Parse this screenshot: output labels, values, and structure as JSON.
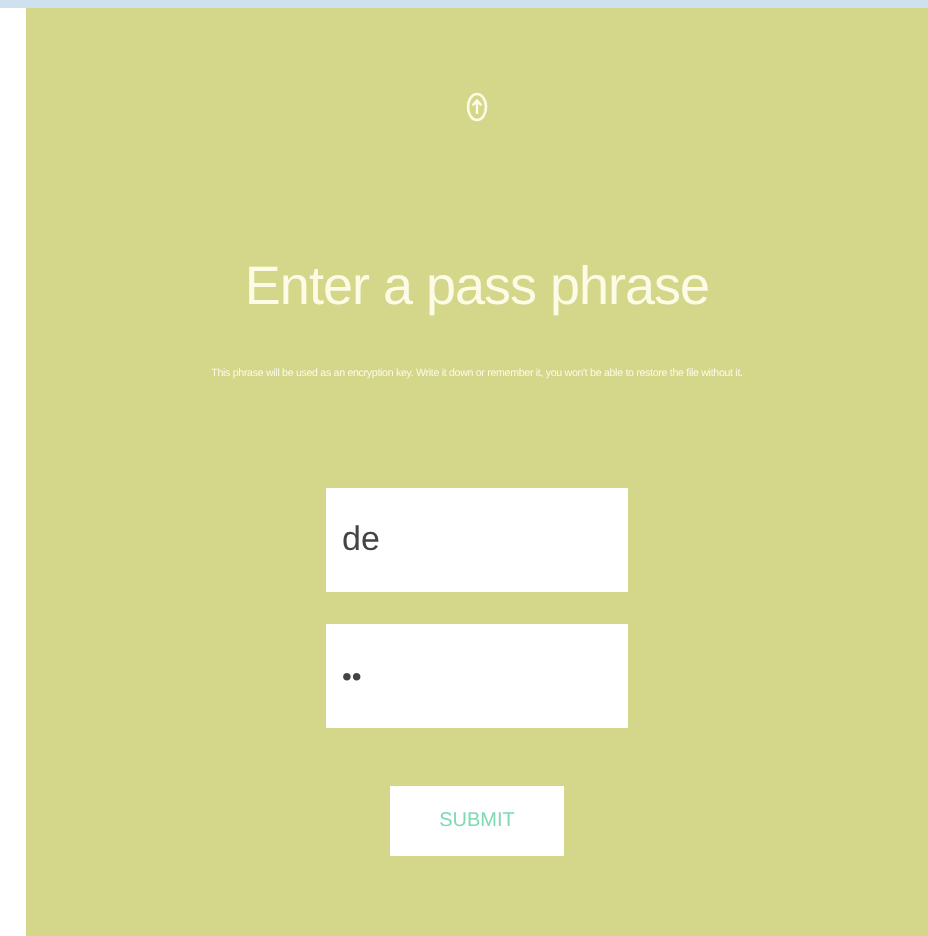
{
  "title": "Enter a pass phrase",
  "description": "This phrase will be used as an encryption key. Write it down or remember it, you won't be able to restore the file without it.",
  "fields": [
    {
      "kind": "text",
      "value": "de"
    },
    {
      "kind": "password",
      "value": "••"
    }
  ],
  "submit_button": {
    "label": "SUBMIT"
  }
}
